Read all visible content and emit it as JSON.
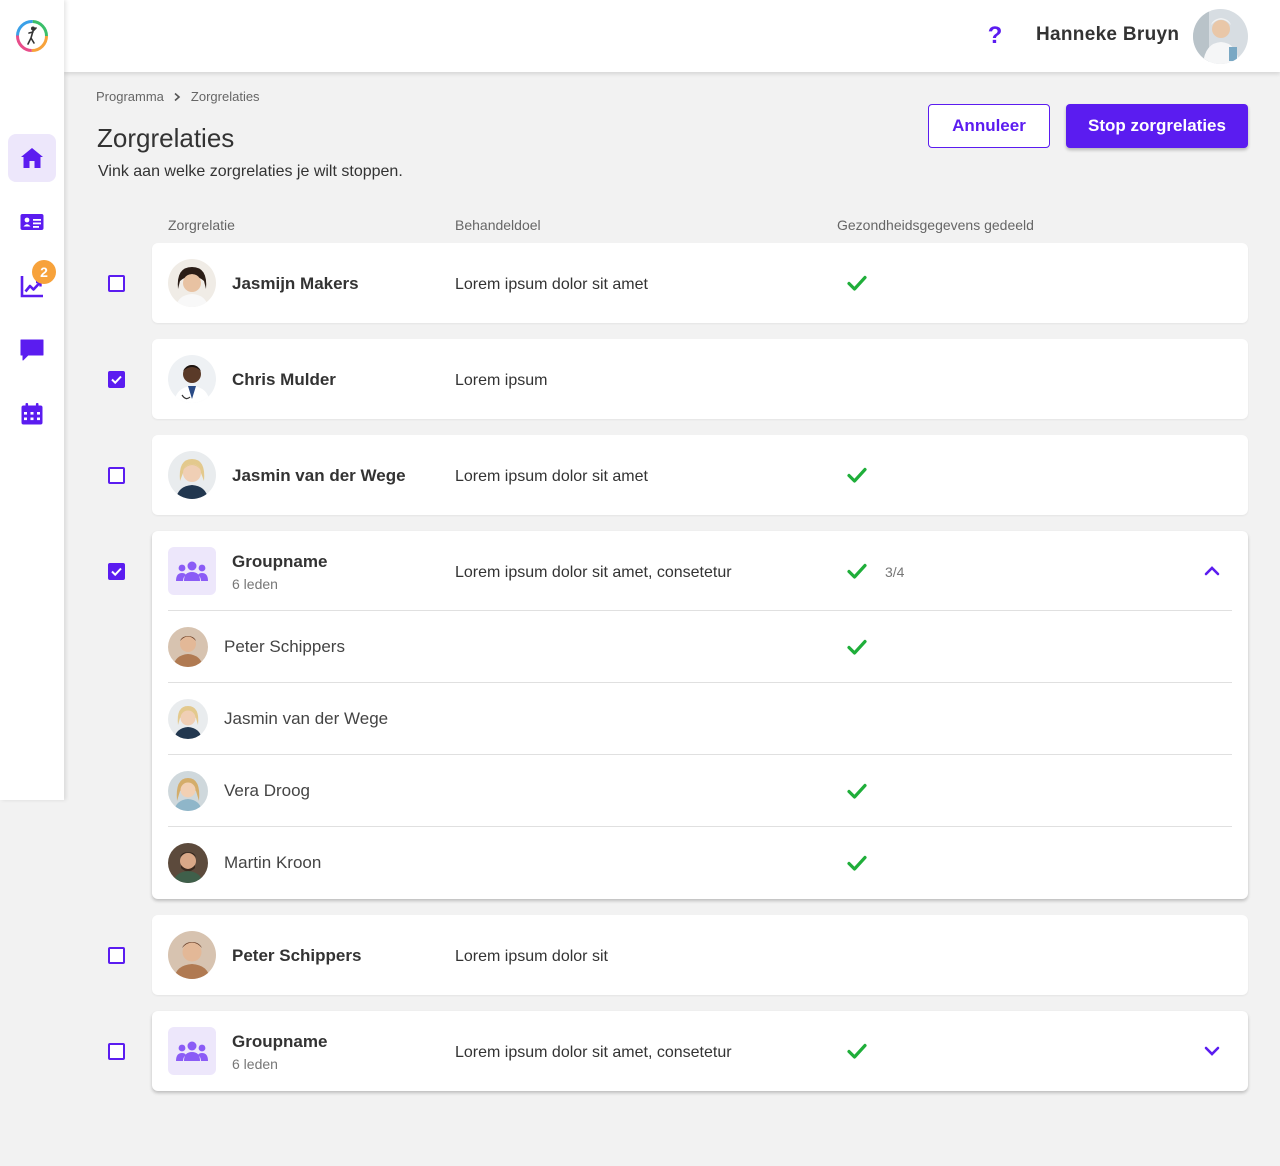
{
  "user": {
    "name": "Hanneke Bruyn"
  },
  "help_icon": "?",
  "nav": {
    "badge_count": "2",
    "icons": [
      "home-icon",
      "id-card-icon",
      "chart-icon",
      "chat-icon",
      "calendar-icon"
    ]
  },
  "breadcrumb": {
    "items": [
      "Programma",
      "Zorgrelaties"
    ]
  },
  "page": {
    "title": "Zorgrelaties",
    "subtitle": "Vink aan welke zorgrelaties je wilt stoppen."
  },
  "buttons": {
    "cancel": "Annuleer",
    "stop": "Stop zorgrelaties"
  },
  "columns": {
    "relation": "Zorgrelatie",
    "goal": "Behandeldoel",
    "shared": "Gezondheidsgegevens gedeeld"
  },
  "colors": {
    "accent": "#5b1cf0",
    "check": "#1fae3a",
    "badge": "#f7a23b",
    "group_bg": "#ede7fb"
  },
  "rows": [
    {
      "name": "Jasmijn Makers",
      "goal": "Lorem ipsum dolor sit amet",
      "shared": true,
      "selected": false
    },
    {
      "name": "Chris Mulder",
      "goal": "Lorem ipsum",
      "shared": false,
      "selected": true
    },
    {
      "name": "Jasmin van der Wege",
      "goal": "Lorem ipsum dolor sit amet",
      "shared": true,
      "selected": false
    },
    {
      "name": "Groupname",
      "members": "6 leden",
      "goal": "Lorem ipsum dolor sit amet, consetetur",
      "shared": true,
      "shared_count": "3/4",
      "selected": true,
      "expanded": true,
      "member_list": [
        {
          "name": "Peter Schippers",
          "shared": true
        },
        {
          "name": "Jasmin van der Wege",
          "shared": false
        },
        {
          "name": "Vera Droog",
          "shared": true
        },
        {
          "name": "Martin Kroon",
          "shared": true
        }
      ]
    },
    {
      "name": "Peter Schippers",
      "goal": "Lorem ipsum dolor sit",
      "shared": false,
      "selected": false
    },
    {
      "name": "Groupname",
      "members": "6 leden",
      "goal": "Lorem ipsum dolor sit amet, consetetur",
      "shared": true,
      "selected": false,
      "expanded": false
    }
  ]
}
